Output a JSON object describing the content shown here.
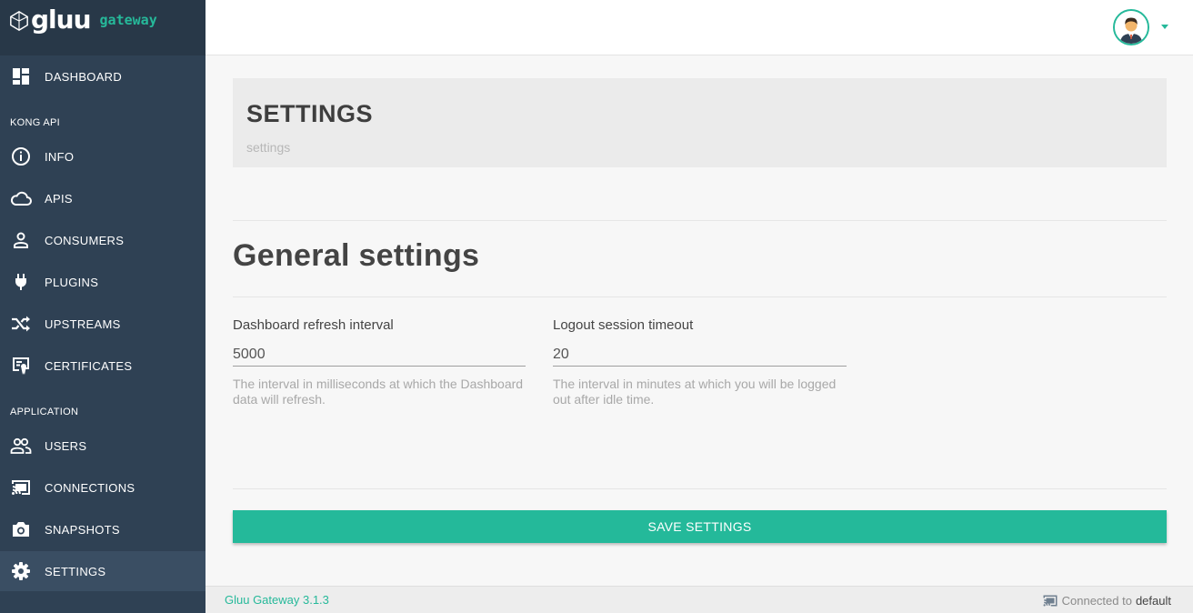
{
  "brand": {
    "name": "gluu",
    "sub": "gateway"
  },
  "sidebar": {
    "dashboard": "DASHBOARD",
    "kong_section": "KONG API",
    "kong_items": [
      "INFO",
      "APIS",
      "CONSUMERS",
      "PLUGINS",
      "UPSTREAMS",
      "CERTIFICATES"
    ],
    "app_section": "APPLICATION",
    "app_items": [
      "USERS",
      "CONNECTIONS",
      "SNAPSHOTS",
      "SETTINGS"
    ],
    "active_item": "SETTINGS"
  },
  "header": {
    "title": "SETTINGS",
    "breadcrumb": "settings"
  },
  "main": {
    "section_title": "General settings",
    "fields": [
      {
        "label": "Dashboard refresh interval",
        "value": "5000",
        "help": "The interval in milliseconds at which the Dashboard data will refresh."
      },
      {
        "label": "Logout session timeout",
        "value": "20",
        "help": "The interval in minutes at which you will be logged out after idle time."
      }
    ],
    "save_label": "SAVE SETTINGS"
  },
  "footer": {
    "version": "Gluu Gateway 3.1.3",
    "connected_prefix": "Connected to",
    "connection": "default"
  },
  "colors": {
    "sidebar": "#2f4154",
    "accent": "#26b99a"
  }
}
